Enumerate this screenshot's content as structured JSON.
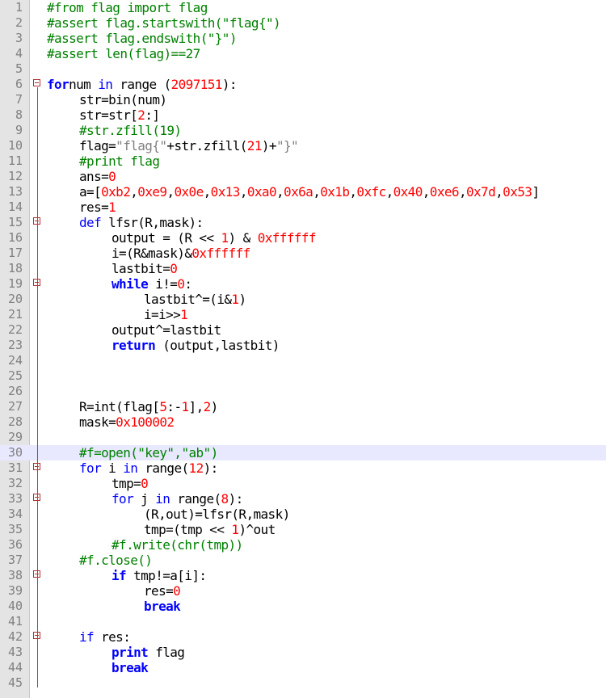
{
  "editor": {
    "highlight_line": 30,
    "lines": [
      {
        "n": "1",
        "indent": 0,
        "tokens": [
          [
            "cmt",
            "#from flag import flag"
          ]
        ]
      },
      {
        "n": "2",
        "indent": 0,
        "tokens": [
          [
            "cmt",
            "#assert flag.startswith(\"flag{\")"
          ]
        ]
      },
      {
        "n": "3",
        "indent": 0,
        "tokens": [
          [
            "cmt",
            "#assert flag.endswith(\"}\")"
          ]
        ]
      },
      {
        "n": "4",
        "indent": 0,
        "tokens": [
          [
            "cmt",
            "#assert len(flag)==27"
          ]
        ]
      },
      {
        "n": "5",
        "indent": 0,
        "tokens": []
      },
      {
        "n": "6",
        "indent": 0,
        "fold": true,
        "tokens": [
          [
            "kw",
            "for"
          ],
          [
            "",
            "num "
          ],
          [
            "kw2",
            "in"
          ],
          [
            "",
            " range "
          ],
          [
            "",
            "("
          ],
          [
            "num",
            "2097151"
          ],
          [
            "",
            "):"
          ]
        ]
      },
      {
        "n": "7",
        "indent": 1,
        "tokens": [
          [
            "",
            "str=bin(num)"
          ]
        ]
      },
      {
        "n": "8",
        "indent": 1,
        "tokens": [
          [
            "",
            "str=str["
          ],
          [
            "num",
            "2"
          ],
          [
            "",
            ":]"
          ]
        ]
      },
      {
        "n": "9",
        "indent": 1,
        "tokens": [
          [
            "cmt",
            "#str.zfill(19)"
          ]
        ]
      },
      {
        "n": "10",
        "indent": 1,
        "tokens": [
          [
            "",
            "flag="
          ],
          [
            "str",
            "\"flag{\""
          ],
          [
            "",
            "+str.zfill("
          ],
          [
            "num",
            "21"
          ],
          [
            "",
            ")+"
          ],
          [
            "str",
            "\"}\""
          ]
        ]
      },
      {
        "n": "11",
        "indent": 1,
        "tokens": [
          [
            "cmt",
            "#print flag"
          ]
        ]
      },
      {
        "n": "12",
        "indent": 1,
        "tokens": [
          [
            "",
            "ans="
          ],
          [
            "num",
            "0"
          ]
        ]
      },
      {
        "n": "13",
        "indent": 1,
        "tokens": [
          [
            "",
            "a=["
          ],
          [
            "num",
            "0xb2"
          ],
          [
            "",
            ","
          ],
          [
            "num",
            "0xe9"
          ],
          [
            "",
            ","
          ],
          [
            "num",
            "0x0e"
          ],
          [
            "",
            ","
          ],
          [
            "num",
            "0x13"
          ],
          [
            "",
            ","
          ],
          [
            "num",
            "0xa0"
          ],
          [
            "",
            ","
          ],
          [
            "num",
            "0x6a"
          ],
          [
            "",
            ","
          ],
          [
            "num",
            "0x1b"
          ],
          [
            "",
            ","
          ],
          [
            "num",
            "0xfc"
          ],
          [
            "",
            ","
          ],
          [
            "num",
            "0x40"
          ],
          [
            "",
            ","
          ],
          [
            "num",
            "0xe6"
          ],
          [
            "",
            ","
          ],
          [
            "num",
            "0x7d"
          ],
          [
            "",
            ","
          ],
          [
            "num",
            "0x53"
          ],
          [
            "",
            "]"
          ]
        ]
      },
      {
        "n": "14",
        "indent": 1,
        "tokens": [
          [
            "",
            "res="
          ],
          [
            "num",
            "1"
          ]
        ]
      },
      {
        "n": "15",
        "indent": 1,
        "fold": true,
        "tokens": [
          [
            "kw2",
            "def "
          ],
          [
            "",
            "lfsr(R,mask):"
          ]
        ]
      },
      {
        "n": "16",
        "indent": 2,
        "tokens": [
          [
            "",
            "output = (R << "
          ],
          [
            "num",
            "1"
          ],
          [
            "",
            ") & "
          ],
          [
            "num",
            "0xffffff"
          ]
        ]
      },
      {
        "n": "17",
        "indent": 2,
        "tokens": [
          [
            "",
            "i=(R&mask)&"
          ],
          [
            "num",
            "0xffffff"
          ]
        ]
      },
      {
        "n": "18",
        "indent": 2,
        "tokens": [
          [
            "",
            "lastbit="
          ],
          [
            "num",
            "0"
          ]
        ]
      },
      {
        "n": "19",
        "indent": 2,
        "fold": true,
        "tokens": [
          [
            "kw",
            "while"
          ],
          [
            "",
            " i!="
          ],
          [
            "num",
            "0"
          ],
          [
            "",
            ":"
          ]
        ]
      },
      {
        "n": "20",
        "indent": 3,
        "tokens": [
          [
            "",
            "lastbit^=(i&"
          ],
          [
            "num",
            "1"
          ],
          [
            "",
            ")"
          ]
        ]
      },
      {
        "n": "21",
        "indent": 3,
        "tokens": [
          [
            "",
            "i=i>>"
          ],
          [
            "num",
            "1"
          ]
        ]
      },
      {
        "n": "22",
        "indent": 2,
        "tokens": [
          [
            "",
            "output^=lastbit"
          ]
        ]
      },
      {
        "n": "23",
        "indent": 2,
        "tokens": [
          [
            "kw",
            "return"
          ],
          [
            "",
            " (output,lastbit)"
          ]
        ]
      },
      {
        "n": "24",
        "indent": 0,
        "tokens": []
      },
      {
        "n": "25",
        "indent": 0,
        "tokens": []
      },
      {
        "n": "26",
        "indent": 0,
        "tokens": []
      },
      {
        "n": "27",
        "indent": 1,
        "tokens": [
          [
            "",
            "R=int(flag["
          ],
          [
            "num",
            "5"
          ],
          [
            "",
            ":-"
          ],
          [
            "num",
            "1"
          ],
          [
            "",
            "],"
          ],
          [
            "num",
            "2"
          ],
          [
            "",
            ")"
          ]
        ]
      },
      {
        "n": "28",
        "indent": 1,
        "tokens": [
          [
            "",
            "mask="
          ],
          [
            "num",
            "0x100002"
          ]
        ]
      },
      {
        "n": "29",
        "indent": 0,
        "tokens": []
      },
      {
        "n": "30",
        "indent": 1,
        "tokens": [
          [
            "cmt",
            "#f=open(\"key\",\"ab\")"
          ]
        ]
      },
      {
        "n": "31",
        "indent": 1,
        "fold": true,
        "tokens": [
          [
            "kw2",
            "for"
          ],
          [
            "",
            " i "
          ],
          [
            "kw2",
            "in"
          ],
          [
            "",
            " range("
          ],
          [
            "num",
            "12"
          ],
          [
            "",
            "):"
          ]
        ]
      },
      {
        "n": "32",
        "indent": 2,
        "tokens": [
          [
            "",
            "tmp="
          ],
          [
            "num",
            "0"
          ]
        ]
      },
      {
        "n": "33",
        "indent": 2,
        "fold": true,
        "tokens": [
          [
            "kw2",
            "for"
          ],
          [
            "",
            " j "
          ],
          [
            "kw2",
            "in"
          ],
          [
            "",
            " range("
          ],
          [
            "num",
            "8"
          ],
          [
            "",
            "):"
          ]
        ]
      },
      {
        "n": "34",
        "indent": 3,
        "tokens": [
          [
            "",
            "(R,out)=lfsr(R,mask)"
          ]
        ]
      },
      {
        "n": "35",
        "indent": 3,
        "tokens": [
          [
            "",
            "tmp=(tmp << "
          ],
          [
            "num",
            "1"
          ],
          [
            "",
            ")^out"
          ]
        ]
      },
      {
        "n": "36",
        "indent": 2,
        "tokens": [
          [
            "cmt",
            "#f.write(chr(tmp))"
          ]
        ]
      },
      {
        "n": "37",
        "indent": 1,
        "tokens": [
          [
            "cmt",
            "#f.close()"
          ]
        ]
      },
      {
        "n": "38",
        "indent": 2,
        "fold": true,
        "tokens": [
          [
            "kw",
            "if"
          ],
          [
            "",
            " tmp!=a[i]:"
          ]
        ]
      },
      {
        "n": "39",
        "indent": 3,
        "tokens": [
          [
            "",
            "res="
          ],
          [
            "num",
            "0"
          ]
        ]
      },
      {
        "n": "40",
        "indent": 3,
        "tokens": [
          [
            "kw",
            "break"
          ]
        ]
      },
      {
        "n": "41",
        "indent": 0,
        "tokens": []
      },
      {
        "n": "42",
        "indent": 1,
        "fold": true,
        "tokens": [
          [
            "kw2",
            "if"
          ],
          [
            "",
            " res:"
          ]
        ]
      },
      {
        "n": "43",
        "indent": 2,
        "tokens": [
          [
            "kw",
            "print"
          ],
          [
            "",
            " flag"
          ]
        ]
      },
      {
        "n": "44",
        "indent": 2,
        "tokens": [
          [
            "kw",
            "break"
          ]
        ]
      },
      {
        "n": "45",
        "indent": 0,
        "tokens": []
      }
    ]
  }
}
